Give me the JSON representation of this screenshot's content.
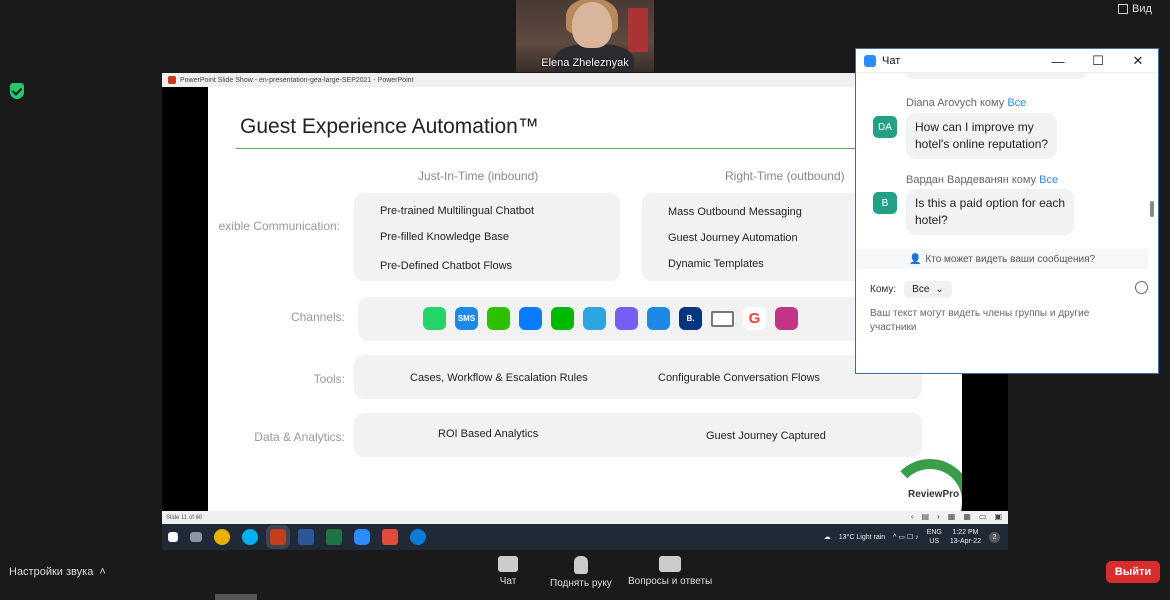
{
  "top": {
    "view_label": "Вид"
  },
  "webcam": {
    "name": "Elena Zheleznyak"
  },
  "ppt": {
    "window_title": "PowerPoint Slide Show - en-presentation-gea-large-SEP2021 - PowerPoint",
    "status_left": "Slide 11 of 60"
  },
  "slide": {
    "title": "Guest Experience Automation™",
    "col_left": "Just-In-Time (inbound)",
    "col_right": "Right-Time (outbound)",
    "row_comm": "exible Communication:",
    "row_channels": "Channels:",
    "row_tools": "Tools:",
    "row_data": "Data & Analytics:",
    "comm_left": [
      "Pre-trained Multilingual Chatbot",
      "Pre-filled Knowledge Base",
      "Pre-Defined Chatbot Flows"
    ],
    "comm_right": [
      "Mass Outbound Messaging",
      "Guest Journey Automation",
      "Dynamic Templates"
    ],
    "channels": [
      {
        "icon": "whatsapp-icon",
        "text": "",
        "color": "#25d366"
      },
      {
        "icon": "sms-icon",
        "text": "SMS",
        "color": "#1e88e5"
      },
      {
        "icon": "wechat-icon",
        "text": "",
        "color": "#2dc100"
      },
      {
        "icon": "messenger-icon",
        "text": "",
        "color": "#0a7cff"
      },
      {
        "icon": "line-icon",
        "text": "",
        "color": "#00b900"
      },
      {
        "icon": "telegram-icon",
        "text": "",
        "color": "#2ca5e0"
      },
      {
        "icon": "viber-icon",
        "text": "",
        "color": "#7360f2"
      },
      {
        "icon": "globe-icon",
        "text": "",
        "color": "#1e88e5"
      },
      {
        "icon": "booking-icon",
        "text": "B.",
        "color": "#003580"
      },
      {
        "icon": "email-icon",
        "text": "",
        "color": "#777777"
      },
      {
        "icon": "google-icon",
        "text": "G",
        "color": "#ea4335"
      },
      {
        "icon": "instagram-icon",
        "text": "",
        "color": "#c13584"
      }
    ],
    "tools_left": "Cases, Workflow & Escalation Rules",
    "tools_right": "Configurable Conversation Flows",
    "data_left": "ROI Based Analytics",
    "data_right": "Guest Journey Captured",
    "logo": "ReviewPro"
  },
  "taskbar": {
    "weather": "13°C  Light rain",
    "lang1": "ENG",
    "lang2": "US",
    "time": "1:22 PM",
    "date": "13-Apr-22",
    "badge": "2"
  },
  "chat": {
    "title": "Чат",
    "messages": [
      {
        "sender": "Diana Arovych",
        "to_word": "кому",
        "to": "Все",
        "avatar": "DA",
        "text1": "How can I improve my",
        "text2": "hotel's online reputation?"
      },
      {
        "sender": "Вардан Вардеванян",
        "to_word": "кому",
        "to": "Все",
        "avatar": "В",
        "text1": "Is this a paid option for each",
        "text2": "hotel?"
      }
    ],
    "who_sees": "Кто может видеть ваши сообщения?",
    "to_label": "Кому:",
    "to_value": "Все",
    "input_hint1": "Ваш текст могут видеть члены группы и другие",
    "input_hint2": "участники"
  },
  "toolbar": {
    "sound": "Настройки звука",
    "chat": "Чат",
    "raise_hand": "Поднять руку",
    "qa": "Вопросы и ответы",
    "leave": "Выйти"
  }
}
